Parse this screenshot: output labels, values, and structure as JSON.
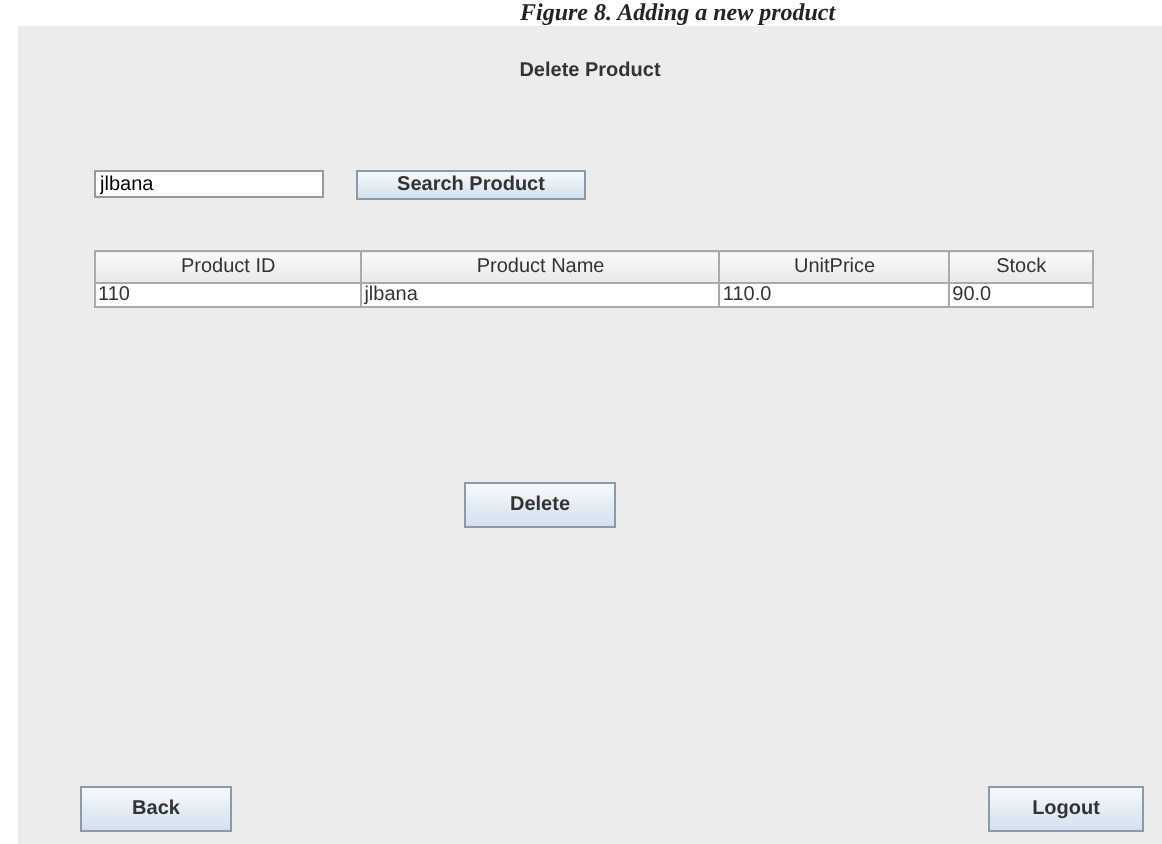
{
  "caption": "Figure 8. Adding a new product",
  "window": {
    "title": "Delete Product"
  },
  "search": {
    "value": "jlbana",
    "button": "Search Product"
  },
  "table": {
    "columns": [
      "Product ID",
      "Product Name",
      "UnitPrice",
      "Stock"
    ],
    "rows": [
      [
        "110",
        "jlbana",
        "110.0",
        "90.0"
      ]
    ]
  },
  "buttons": {
    "delete": "Delete",
    "back": "Back",
    "logout": "Logout"
  }
}
